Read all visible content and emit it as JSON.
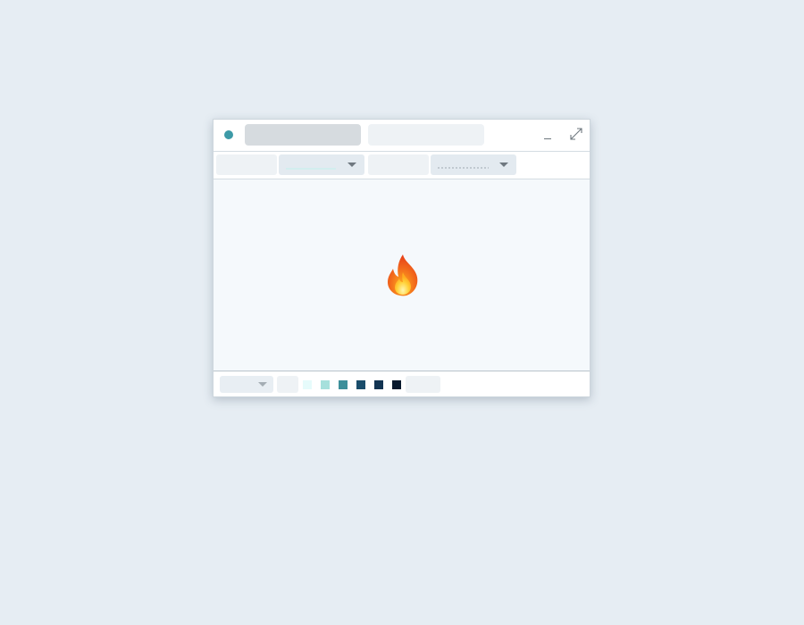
{
  "titlebar": {
    "status_dot_color": "#3d9aa7",
    "minimize_icon": "minimize-icon",
    "maximize_icon": "expand-arrows-icon"
  },
  "canvas": {
    "icon": "fire-icon",
    "icon_glyph": "🔥"
  },
  "palette": {
    "colors": [
      "#e6fbfb",
      "#a6e0dc",
      "#3d8f9a",
      "#1a4d6b",
      "#123452",
      "#08192d"
    ]
  }
}
